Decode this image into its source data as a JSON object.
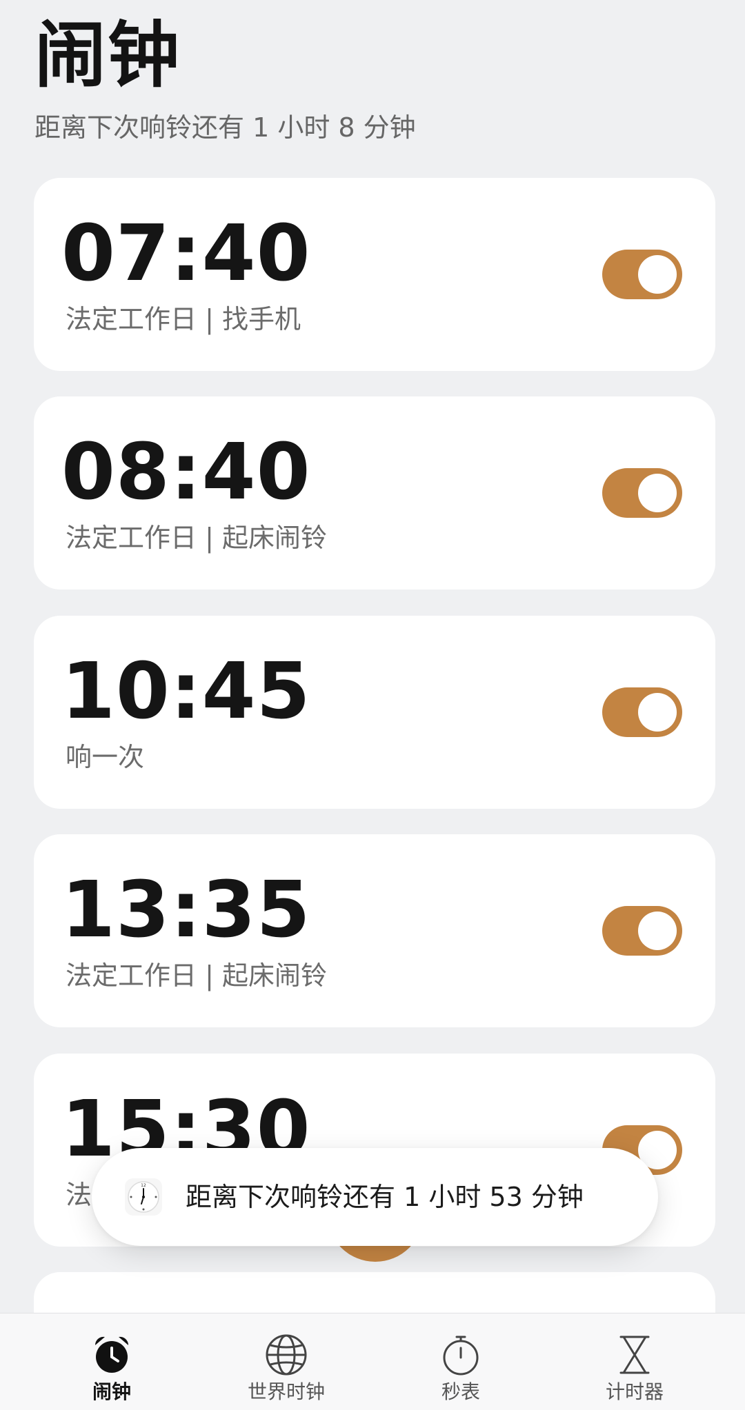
{
  "header": {
    "title": "闹钟",
    "subtitle": "距离下次响铃还有 1 小时 8 分钟"
  },
  "alarms": [
    {
      "time": "07:40",
      "desc": "法定工作日 | 找手机",
      "enabled": true
    },
    {
      "time": "08:40",
      "desc": "法定工作日 | 起床闹铃",
      "enabled": true
    },
    {
      "time": "10:45",
      "desc": "响一次",
      "enabled": true
    },
    {
      "time": "13:35",
      "desc": "法定工作日 | 起床闹铃",
      "enabled": true
    },
    {
      "time": "15:30",
      "desc": "法",
      "enabled": true
    }
  ],
  "toast": {
    "text": "距离下次响铃还有 1 小时 53 分钟",
    "icon": "clock-app-icon"
  },
  "tabbar": {
    "active": 0,
    "items": [
      {
        "label": "闹钟",
        "icon": "alarm-clock-icon"
      },
      {
        "label": "世界时钟",
        "icon": "globe-icon"
      },
      {
        "label": "秒表",
        "icon": "stopwatch-icon"
      },
      {
        "label": "计时器",
        "icon": "hourglass-icon"
      }
    ]
  },
  "colors": {
    "accent": "#c38442",
    "background": "#eff0f2",
    "card": "#ffffff"
  }
}
